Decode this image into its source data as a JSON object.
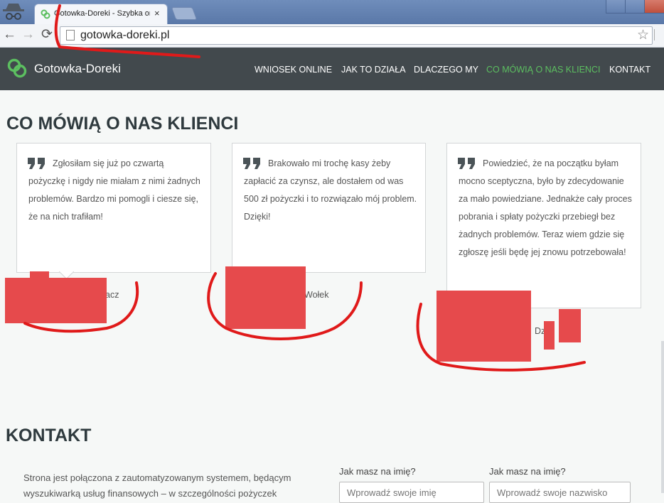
{
  "browser": {
    "tab_title": "Gotowka-Doreki - Szybka on",
    "tab_close": "×",
    "url": "gotowka-doreki.pl",
    "back": "←",
    "forward": "→",
    "reload": "⟳",
    "star": "☆"
  },
  "site": {
    "brand": "Gotowka-Doreki",
    "nav": [
      {
        "label": "WNIOSEK ONLINE"
      },
      {
        "label": "JAK TO DZIAŁA"
      },
      {
        "label": "DLACZEGO MY"
      },
      {
        "label": "CO MÓWIĄ O NAS KLIENCI"
      },
      {
        "label": "KONTAKT"
      }
    ],
    "active_color": "#5cbf60",
    "header_bg": "#42494d"
  },
  "testimonials": {
    "heading": "CO MÓWIĄ O NAS KLIENCI",
    "items": [
      {
        "text": "Zgłosiłam się już po czwartą pożyczkę i nigdy nie miałam z nimi żadnych problemów. Bardzo mi pomogli i ciesze się, że na nich trafiłam!",
        "author_visible": "acz"
      },
      {
        "text": "Brakowało mi trochę kasy żeby zapłacić za czynsz, ale dostałem od was 500 zł pożyczki i to rozwiązało mój problem. Dzięki!",
        "author_visible": "Wołek"
      },
      {
        "text": "Powiedzieć, że na początku byłam mocno sceptyczna, było by zdecydowanie za mało powiedziane. Jednakże cały proces pobrania i spłaty pożyczki przebiegł bez żadnych problemów. Teraz wiem gdzie się zgłoszę jeśli będę jej znowu potrzebowała!",
        "author_visible": "Dzid"
      }
    ]
  },
  "contact": {
    "heading": "KONTAKT",
    "paragraph": "Strona jest połączona z zautomatyzowanym systemem, będącym wyszukiwarką usług finansowych – w szczególności pożyczek",
    "fields": [
      {
        "label": "Jak masz na imię?",
        "placeholder": "Wprowadź swoje imię"
      },
      {
        "label": "Jak masz na imię?",
        "placeholder": "Wprowadź swoje nazwisko"
      }
    ]
  },
  "annotation_color": "#e64a4c"
}
